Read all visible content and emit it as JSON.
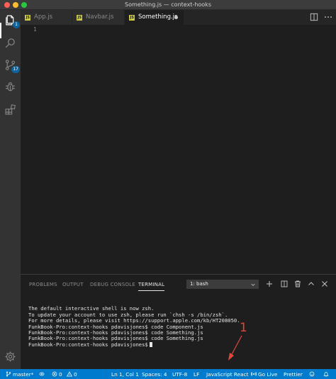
{
  "window": {
    "title": "Something.js — context-hooks"
  },
  "activity_bar": {
    "explorer_badge": "1",
    "scm_badge": "17"
  },
  "tabs": [
    {
      "label": "App.js",
      "icon": "js-file-icon",
      "active": false
    },
    {
      "label": "Navbar.js",
      "icon": "js-file-icon",
      "active": false
    },
    {
      "label": "Something.js",
      "icon": "js-file-icon",
      "active": true,
      "dirty": true
    }
  ],
  "editor": {
    "line_numbers": [
      "1"
    ]
  },
  "panel": {
    "tabs": [
      "PROBLEMS",
      "OUTPUT",
      "DEBUG CONSOLE",
      "TERMINAL"
    ],
    "active_tab": "TERMINAL",
    "terminal_select": "1: bash",
    "terminal_lines": [
      "The default interactive shell is now zsh.",
      "To update your account to use zsh, please run `chsh -s /bin/zsh`.",
      "For more details, please visit https://support.apple.com/kb/HT208050.",
      "FunkBook-Pro:context-hooks pdavisjones$ code Component.js",
      "FunkBook-Pro:context-hooks pdavisjones$ code Something.js",
      "FunkBook-Pro:context-hooks pdavisjones$ code Something.js",
      "FunkBook-Pro:context-hooks pdavisjones$"
    ]
  },
  "annotation": {
    "label": "1",
    "color": "#e0483a"
  },
  "status_bar": {
    "branch": "master*",
    "errors": "0",
    "warnings": "0",
    "position": "Ln 1, Col 1",
    "spaces": "Spaces: 4",
    "encoding": "UTF-8",
    "eol": "LF",
    "language": "JavaScript React",
    "go_live": "Go Live",
    "prettier": "Prettier",
    "background": "#007acc"
  },
  "colors": {
    "editor_bg": "#1e1e1e",
    "activity_bar_bg": "#333333",
    "tab_bar_bg": "#252526",
    "accent": "#007acc"
  }
}
